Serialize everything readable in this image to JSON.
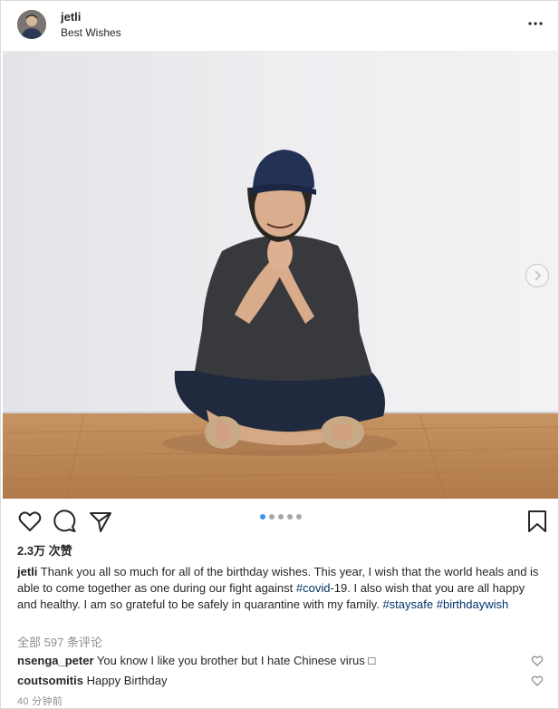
{
  "header": {
    "username": "jetli",
    "location": "Best Wishes"
  },
  "actions": {
    "carousel_count": 5,
    "carousel_active": 1
  },
  "post": {
    "likes": "2.3万 次赞",
    "caption_user": "jetli",
    "caption_text_1": " Thank you all so much for all of the birthday wishes. This year, I wish that the world heals and is able to come together as one during our fight against ",
    "caption_tag_1": "#covid",
    "caption_text_2": "-19. I also wish that you are all happy and healthy. I am so grateful to be safely in quarantine with my family. ",
    "caption_tag_2": "#staysafe",
    "caption_tag_3": "#birthdaywish",
    "all_comments": "全部 597 条评论",
    "comments": [
      {
        "user": "nsenga_peter",
        "text": " You know I like you brother but I hate Chinese virus □"
      },
      {
        "user": "coutsomitis",
        "text": " Happy Birthday"
      }
    ],
    "time": "40 分钟前"
  },
  "colors": {
    "accent": "#3897f0",
    "hashtag": "#003569",
    "muted": "#8e8e8e"
  }
}
